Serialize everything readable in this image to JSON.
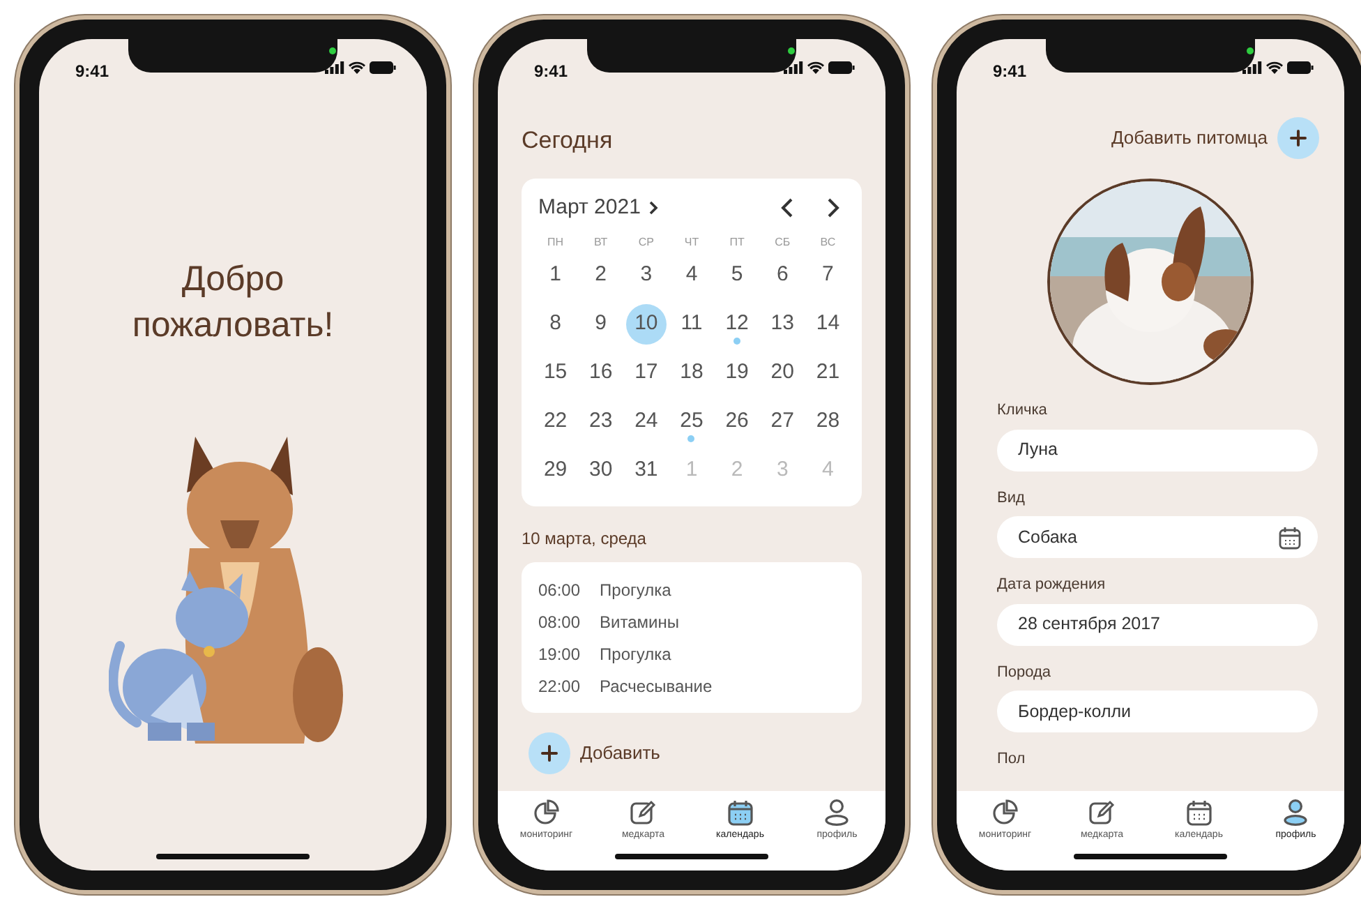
{
  "screens": [
    {
      "kind": "welcome",
      "time": "9:41",
      "title": "Добро пожаловать!"
    },
    {
      "kind": "calendar",
      "time": "9:41",
      "heading": "Сегодня",
      "month": "Март 2021",
      "weekdays": [
        "ПН",
        "ВТ",
        "СР",
        "ЧТ",
        "ПТ",
        "СБ",
        "ВС"
      ],
      "days": [
        {
          "label": "1",
          "in_month": true,
          "selected": false,
          "event": false
        },
        {
          "label": "2",
          "in_month": true,
          "selected": false,
          "event": false
        },
        {
          "label": "3",
          "in_month": true,
          "selected": false,
          "event": false
        },
        {
          "label": "4",
          "in_month": true,
          "selected": false,
          "event": false
        },
        {
          "label": "5",
          "in_month": true,
          "selected": false,
          "event": false
        },
        {
          "label": "6",
          "in_month": true,
          "selected": false,
          "event": false
        },
        {
          "label": "7",
          "in_month": true,
          "selected": false,
          "event": false
        },
        {
          "label": "8",
          "in_month": true,
          "selected": false,
          "event": false
        },
        {
          "label": "9",
          "in_month": true,
          "selected": false,
          "event": false
        },
        {
          "label": "10",
          "in_month": true,
          "selected": true,
          "event": false
        },
        {
          "label": "11",
          "in_month": true,
          "selected": false,
          "event": false
        },
        {
          "label": "12",
          "in_month": true,
          "selected": false,
          "event": true
        },
        {
          "label": "13",
          "in_month": true,
          "selected": false,
          "event": false
        },
        {
          "label": "14",
          "in_month": true,
          "selected": false,
          "event": false
        },
        {
          "label": "15",
          "in_month": true,
          "selected": false,
          "event": false
        },
        {
          "label": "16",
          "in_month": true,
          "selected": false,
          "event": false
        },
        {
          "label": "17",
          "in_month": true,
          "selected": false,
          "event": false
        },
        {
          "label": "18",
          "in_month": true,
          "selected": false,
          "event": false
        },
        {
          "label": "19",
          "in_month": true,
          "selected": false,
          "event": false
        },
        {
          "label": "20",
          "in_month": true,
          "selected": false,
          "event": false
        },
        {
          "label": "21",
          "in_month": true,
          "selected": false,
          "event": false
        },
        {
          "label": "22",
          "in_month": true,
          "selected": false,
          "event": false
        },
        {
          "label": "23",
          "in_month": true,
          "selected": false,
          "event": false
        },
        {
          "label": "24",
          "in_month": true,
          "selected": false,
          "event": false
        },
        {
          "label": "25",
          "in_month": true,
          "selected": false,
          "event": true
        },
        {
          "label": "26",
          "in_month": true,
          "selected": false,
          "event": false
        },
        {
          "label": "27",
          "in_month": true,
          "selected": false,
          "event": false
        },
        {
          "label": "28",
          "in_month": true,
          "selected": false,
          "event": false
        },
        {
          "label": "29",
          "in_month": true,
          "selected": false,
          "event": false
        },
        {
          "label": "30",
          "in_month": true,
          "selected": false,
          "event": false
        },
        {
          "label": "31",
          "in_month": true,
          "selected": false,
          "event": false
        },
        {
          "label": "1",
          "in_month": false,
          "selected": false,
          "event": false
        },
        {
          "label": "2",
          "in_month": false,
          "selected": false,
          "event": false
        },
        {
          "label": "3",
          "in_month": false,
          "selected": false,
          "event": false
        },
        {
          "label": "4",
          "in_month": false,
          "selected": false,
          "event": false
        }
      ],
      "date_label": "10 марта, среда",
      "events": [
        {
          "time": "06:00",
          "title": "Прогулка"
        },
        {
          "time": "08:00",
          "title": "Витамины"
        },
        {
          "time": "19:00",
          "title": "Прогулка"
        },
        {
          "time": "22:00",
          "title": "Расчесывание"
        }
      ],
      "add_label": "Добавить",
      "nav": [
        {
          "label": "мониторинг",
          "selected": false
        },
        {
          "label": "медкарта",
          "selected": false
        },
        {
          "label": "календарь",
          "selected": true
        },
        {
          "label": "профиль",
          "selected": false
        }
      ]
    },
    {
      "kind": "profile",
      "time": "9:41",
      "add_pet_label": "Добавить питомца",
      "photo": {
        "kind": "picture"
      },
      "fields": [
        {
          "label": "Кличка",
          "value": "Луна",
          "kind": "text"
        },
        {
          "label": "Вид",
          "value": "Собака",
          "kind": "picker"
        },
        {
          "label": "Дата рождения",
          "value": "28 сентября 2017",
          "kind": "text"
        },
        {
          "label": "Порода",
          "value": "Бордер-колли",
          "kind": "text"
        },
        {
          "label": "Пол",
          "kind": "label-only"
        }
      ],
      "nav": [
        {
          "label": "мониторинг",
          "selected": false
        },
        {
          "label": "медкарта",
          "selected": false
        },
        {
          "label": "календарь",
          "selected": false
        },
        {
          "label": "профиль",
          "selected": true
        }
      ]
    }
  ]
}
